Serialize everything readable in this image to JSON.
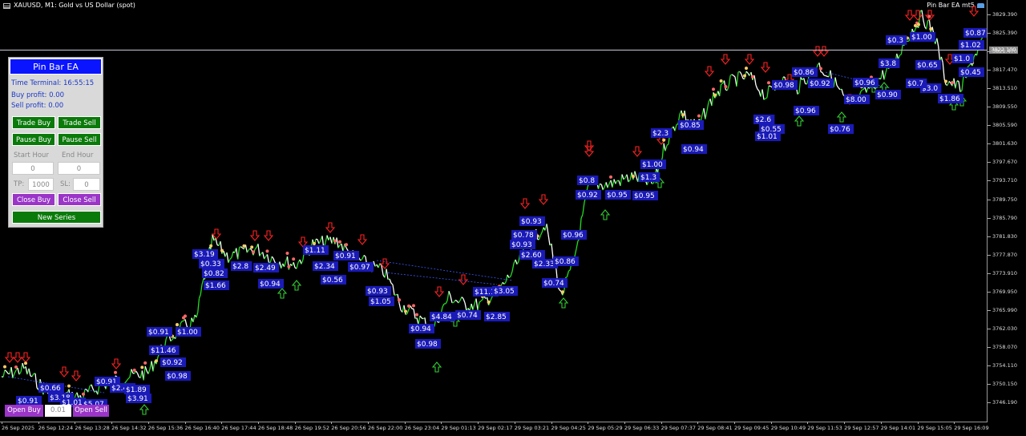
{
  "window": {
    "title": "XAUUSD, M1:  Gold vs US Dollar (spot)",
    "ea_label": "Pin Bar EA mt5"
  },
  "price_axis": {
    "ticks": [
      "3829.390",
      "3825.390",
      "3821.470",
      "3817.470",
      "3813.510",
      "3809.550",
      "3805.590",
      "3801.630",
      "3797.670",
      "3793.710",
      "3789.750",
      "3785.790",
      "3781.830",
      "3777.870",
      "3773.910",
      "3769.950",
      "3765.990",
      "3762.030",
      "3758.070",
      "3754.110",
      "3750.150",
      "3746.190"
    ],
    "current_price": "3822.100"
  },
  "time_axis": {
    "ticks": [
      "26 Sep 2025",
      "26 Sep 12:24",
      "26 Sep 13:28",
      "26 Sep 14:32",
      "26 Sep 15:36",
      "26 Sep 16:40",
      "26 Sep 17:44",
      "26 Sep 18:48",
      "26 Sep 19:52",
      "26 Sep 20:56",
      "26 Sep 22:00",
      "26 Sep 23:04",
      "29 Sep 01:13",
      "29 Sep 02:17",
      "29 Sep 03:21",
      "29 Sep 04:25",
      "29 Sep 05:29",
      "29 Sep 06:33",
      "29 Sep 07:37",
      "29 Sep 08:41",
      "29 Sep 09:45",
      "29 Sep 10:49",
      "29 Sep 11:53",
      "29 Sep 12:57",
      "29 Sep 14:01",
      "29 Sep 15:05",
      "29 Sep 16:09"
    ]
  },
  "panel": {
    "title": "Pin Bar EA",
    "time_terminal": "Time Terminal: 16:55:15",
    "buy_profit": "Buy profit: 0.00",
    "sell_profit": "Sell profit: 0.00",
    "trade_buy": "Trade Buy",
    "trade_sell": "Trade Sell",
    "pause_buy": "Pause Buy",
    "pause_sell": "Pause Sell",
    "start_hour_label": "Start Hour",
    "end_hour_label": "End Hour",
    "start_hour": "0",
    "end_hour": "0",
    "tp_label": "TP:",
    "tp_value": "1000",
    "sl_label": "SL:",
    "sl_value": "0",
    "close_buy": "Close Buy",
    "close_sell": "Close Sell",
    "new_series": "New Series"
  },
  "bottom": {
    "open_buy": "Open Buy",
    "lot": "0.01",
    "open_sell": "Open Sell"
  },
  "profit_labels": [
    "$0.91",
    "$0.66",
    "$3.18",
    "$1.01",
    "$5.07",
    "$0.91",
    "$2.44",
    "$1.89",
    "$3.91",
    "$0.91",
    "$1.00",
    "$11.46",
    "$0.92",
    "$0.98",
    "$3.19",
    "$0.33",
    "$0.82",
    "$1.66",
    "$2.8",
    "$2.49",
    "$0.94",
    "$1.11",
    "$2.34",
    "$0.91",
    "$0.97",
    "$0.56",
    "$0.93",
    "$1.05",
    "$0.94",
    "$0.98",
    "$4.84",
    "$0.74",
    "$11.1",
    "$3.05",
    "$2.85",
    "$0.93",
    "$0.78",
    "$0.93",
    "$2.60",
    "$2.33",
    "$0.86",
    "$0.96",
    "$0.74",
    "$0.8",
    "$0.95",
    "$0.92",
    "$0.95",
    "$1.3",
    "$1.00",
    "$2.3",
    "$0.94",
    "$0.85",
    "$2.6",
    "$0.55",
    "$1.01",
    "$0.96",
    "$0.98",
    "$0.86",
    "$0.92",
    "$8.00",
    "$0.76",
    "$0.96",
    "$0.90",
    "$3.8",
    "$0.65",
    "$3.0",
    "$1.86",
    "$0.45",
    "$1.0",
    "$1.02",
    "$0.87",
    "$0.3",
    "$1.00",
    "$0.7"
  ],
  "colors": {
    "background": "#000000",
    "up_line": "#22dd22",
    "down_line": "#ffffff",
    "buy_arrow": "#33cc33",
    "sell_arrow": "#ff2222",
    "label_bg": "#1a1ab8",
    "panel_bg": "#d9d9d9",
    "header_blue": "#0a14ff",
    "button_green": "#0a7a0a",
    "button_purple": "#9a35c8"
  }
}
